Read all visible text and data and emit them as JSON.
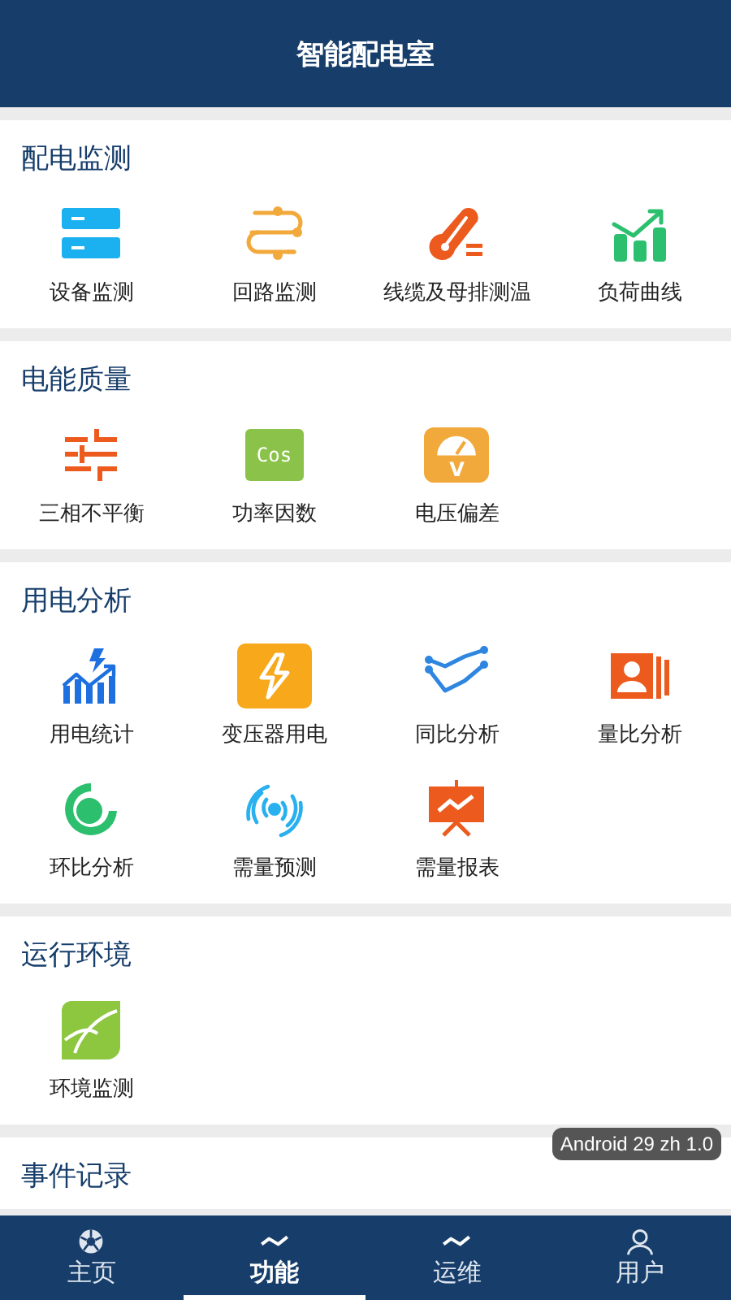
{
  "header": {
    "title": "智能配电室"
  },
  "sections": [
    {
      "title": "配电监测",
      "items": [
        {
          "label": "设备监测",
          "kind": "server"
        },
        {
          "label": "回路监测",
          "kind": "route"
        },
        {
          "label": "线缆及母排测温",
          "kind": "thermo"
        },
        {
          "label": "负荷曲线",
          "kind": "bars"
        }
      ]
    },
    {
      "title": "电能质量",
      "items": [
        {
          "label": "三相不平衡",
          "kind": "sliders"
        },
        {
          "label": "功率因数",
          "kind": "cos",
          "icon_text": "Cos"
        },
        {
          "label": "电压偏差",
          "kind": "gauge",
          "icon_text": "V"
        }
      ]
    },
    {
      "title": "用电分析",
      "items": [
        {
          "label": "用电统计",
          "kind": "boltchart"
        },
        {
          "label": "变压器用电",
          "kind": "bolttile"
        },
        {
          "label": "同比分析",
          "kind": "lines"
        },
        {
          "label": "量比分析",
          "kind": "panel"
        },
        {
          "label": "环比分析",
          "kind": "ring"
        },
        {
          "label": "需量预测",
          "kind": "signal"
        },
        {
          "label": "需量报表",
          "kind": "board"
        }
      ]
    },
    {
      "title": "运行环境",
      "items": [
        {
          "label": "环境监测",
          "kind": "leaf"
        }
      ]
    },
    {
      "title": "事件记录"
    }
  ],
  "toast": "Android 29 zh 1.0",
  "tabs": [
    {
      "label": "主页",
      "kind": "aperture",
      "selected": false
    },
    {
      "label": "功能",
      "kind": "wave",
      "selected": true
    },
    {
      "label": "运维",
      "kind": "wave",
      "selected": false
    },
    {
      "label": "用户",
      "kind": "person",
      "selected": false
    }
  ]
}
